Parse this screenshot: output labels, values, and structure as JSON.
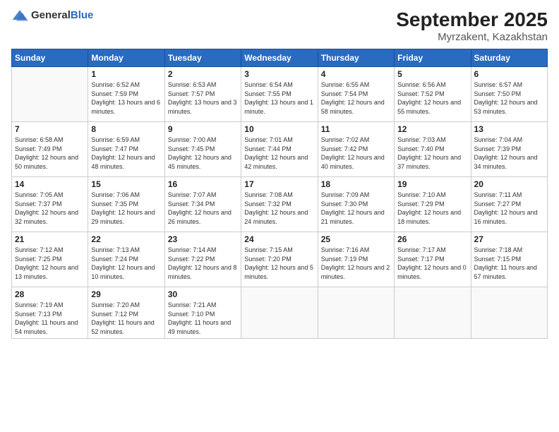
{
  "logo": {
    "general": "General",
    "blue": "Blue"
  },
  "header": {
    "month": "September 2025",
    "location": "Myrzakent, Kazakhstan"
  },
  "days_of_week": [
    "Sunday",
    "Monday",
    "Tuesday",
    "Wednesday",
    "Thursday",
    "Friday",
    "Saturday"
  ],
  "weeks": [
    [
      {
        "day": "",
        "sunrise": "",
        "sunset": "",
        "daylight": ""
      },
      {
        "day": "1",
        "sunrise": "Sunrise: 6:52 AM",
        "sunset": "Sunset: 7:59 PM",
        "daylight": "Daylight: 13 hours and 6 minutes."
      },
      {
        "day": "2",
        "sunrise": "Sunrise: 6:53 AM",
        "sunset": "Sunset: 7:57 PM",
        "daylight": "Daylight: 13 hours and 3 minutes."
      },
      {
        "day": "3",
        "sunrise": "Sunrise: 6:54 AM",
        "sunset": "Sunset: 7:55 PM",
        "daylight": "Daylight: 13 hours and 1 minute."
      },
      {
        "day": "4",
        "sunrise": "Sunrise: 6:55 AM",
        "sunset": "Sunset: 7:54 PM",
        "daylight": "Daylight: 12 hours and 58 minutes."
      },
      {
        "day": "5",
        "sunrise": "Sunrise: 6:56 AM",
        "sunset": "Sunset: 7:52 PM",
        "daylight": "Daylight: 12 hours and 55 minutes."
      },
      {
        "day": "6",
        "sunrise": "Sunrise: 6:57 AM",
        "sunset": "Sunset: 7:50 PM",
        "daylight": "Daylight: 12 hours and 53 minutes."
      }
    ],
    [
      {
        "day": "7",
        "sunrise": "Sunrise: 6:58 AM",
        "sunset": "Sunset: 7:49 PM",
        "daylight": "Daylight: 12 hours and 50 minutes."
      },
      {
        "day": "8",
        "sunrise": "Sunrise: 6:59 AM",
        "sunset": "Sunset: 7:47 PM",
        "daylight": "Daylight: 12 hours and 48 minutes."
      },
      {
        "day": "9",
        "sunrise": "Sunrise: 7:00 AM",
        "sunset": "Sunset: 7:45 PM",
        "daylight": "Daylight: 12 hours and 45 minutes."
      },
      {
        "day": "10",
        "sunrise": "Sunrise: 7:01 AM",
        "sunset": "Sunset: 7:44 PM",
        "daylight": "Daylight: 12 hours and 42 minutes."
      },
      {
        "day": "11",
        "sunrise": "Sunrise: 7:02 AM",
        "sunset": "Sunset: 7:42 PM",
        "daylight": "Daylight: 12 hours and 40 minutes."
      },
      {
        "day": "12",
        "sunrise": "Sunrise: 7:03 AM",
        "sunset": "Sunset: 7:40 PM",
        "daylight": "Daylight: 12 hours and 37 minutes."
      },
      {
        "day": "13",
        "sunrise": "Sunrise: 7:04 AM",
        "sunset": "Sunset: 7:39 PM",
        "daylight": "Daylight: 12 hours and 34 minutes."
      }
    ],
    [
      {
        "day": "14",
        "sunrise": "Sunrise: 7:05 AM",
        "sunset": "Sunset: 7:37 PM",
        "daylight": "Daylight: 12 hours and 32 minutes."
      },
      {
        "day": "15",
        "sunrise": "Sunrise: 7:06 AM",
        "sunset": "Sunset: 7:35 PM",
        "daylight": "Daylight: 12 hours and 29 minutes."
      },
      {
        "day": "16",
        "sunrise": "Sunrise: 7:07 AM",
        "sunset": "Sunset: 7:34 PM",
        "daylight": "Daylight: 12 hours and 26 minutes."
      },
      {
        "day": "17",
        "sunrise": "Sunrise: 7:08 AM",
        "sunset": "Sunset: 7:32 PM",
        "daylight": "Daylight: 12 hours and 24 minutes."
      },
      {
        "day": "18",
        "sunrise": "Sunrise: 7:09 AM",
        "sunset": "Sunset: 7:30 PM",
        "daylight": "Daylight: 12 hours and 21 minutes."
      },
      {
        "day": "19",
        "sunrise": "Sunrise: 7:10 AM",
        "sunset": "Sunset: 7:29 PM",
        "daylight": "Daylight: 12 hours and 18 minutes."
      },
      {
        "day": "20",
        "sunrise": "Sunrise: 7:11 AM",
        "sunset": "Sunset: 7:27 PM",
        "daylight": "Daylight: 12 hours and 16 minutes."
      }
    ],
    [
      {
        "day": "21",
        "sunrise": "Sunrise: 7:12 AM",
        "sunset": "Sunset: 7:25 PM",
        "daylight": "Daylight: 12 hours and 13 minutes."
      },
      {
        "day": "22",
        "sunrise": "Sunrise: 7:13 AM",
        "sunset": "Sunset: 7:24 PM",
        "daylight": "Daylight: 12 hours and 10 minutes."
      },
      {
        "day": "23",
        "sunrise": "Sunrise: 7:14 AM",
        "sunset": "Sunset: 7:22 PM",
        "daylight": "Daylight: 12 hours and 8 minutes."
      },
      {
        "day": "24",
        "sunrise": "Sunrise: 7:15 AM",
        "sunset": "Sunset: 7:20 PM",
        "daylight": "Daylight: 12 hours and 5 minutes."
      },
      {
        "day": "25",
        "sunrise": "Sunrise: 7:16 AM",
        "sunset": "Sunset: 7:19 PM",
        "daylight": "Daylight: 12 hours and 2 minutes."
      },
      {
        "day": "26",
        "sunrise": "Sunrise: 7:17 AM",
        "sunset": "Sunset: 7:17 PM",
        "daylight": "Daylight: 12 hours and 0 minutes."
      },
      {
        "day": "27",
        "sunrise": "Sunrise: 7:18 AM",
        "sunset": "Sunset: 7:15 PM",
        "daylight": "Daylight: 11 hours and 57 minutes."
      }
    ],
    [
      {
        "day": "28",
        "sunrise": "Sunrise: 7:19 AM",
        "sunset": "Sunset: 7:13 PM",
        "daylight": "Daylight: 11 hours and 54 minutes."
      },
      {
        "day": "29",
        "sunrise": "Sunrise: 7:20 AM",
        "sunset": "Sunset: 7:12 PM",
        "daylight": "Daylight: 11 hours and 52 minutes."
      },
      {
        "day": "30",
        "sunrise": "Sunrise: 7:21 AM",
        "sunset": "Sunset: 7:10 PM",
        "daylight": "Daylight: 11 hours and 49 minutes."
      },
      {
        "day": "",
        "sunrise": "",
        "sunset": "",
        "daylight": ""
      },
      {
        "day": "",
        "sunrise": "",
        "sunset": "",
        "daylight": ""
      },
      {
        "day": "",
        "sunrise": "",
        "sunset": "",
        "daylight": ""
      },
      {
        "day": "",
        "sunrise": "",
        "sunset": "",
        "daylight": ""
      }
    ]
  ]
}
